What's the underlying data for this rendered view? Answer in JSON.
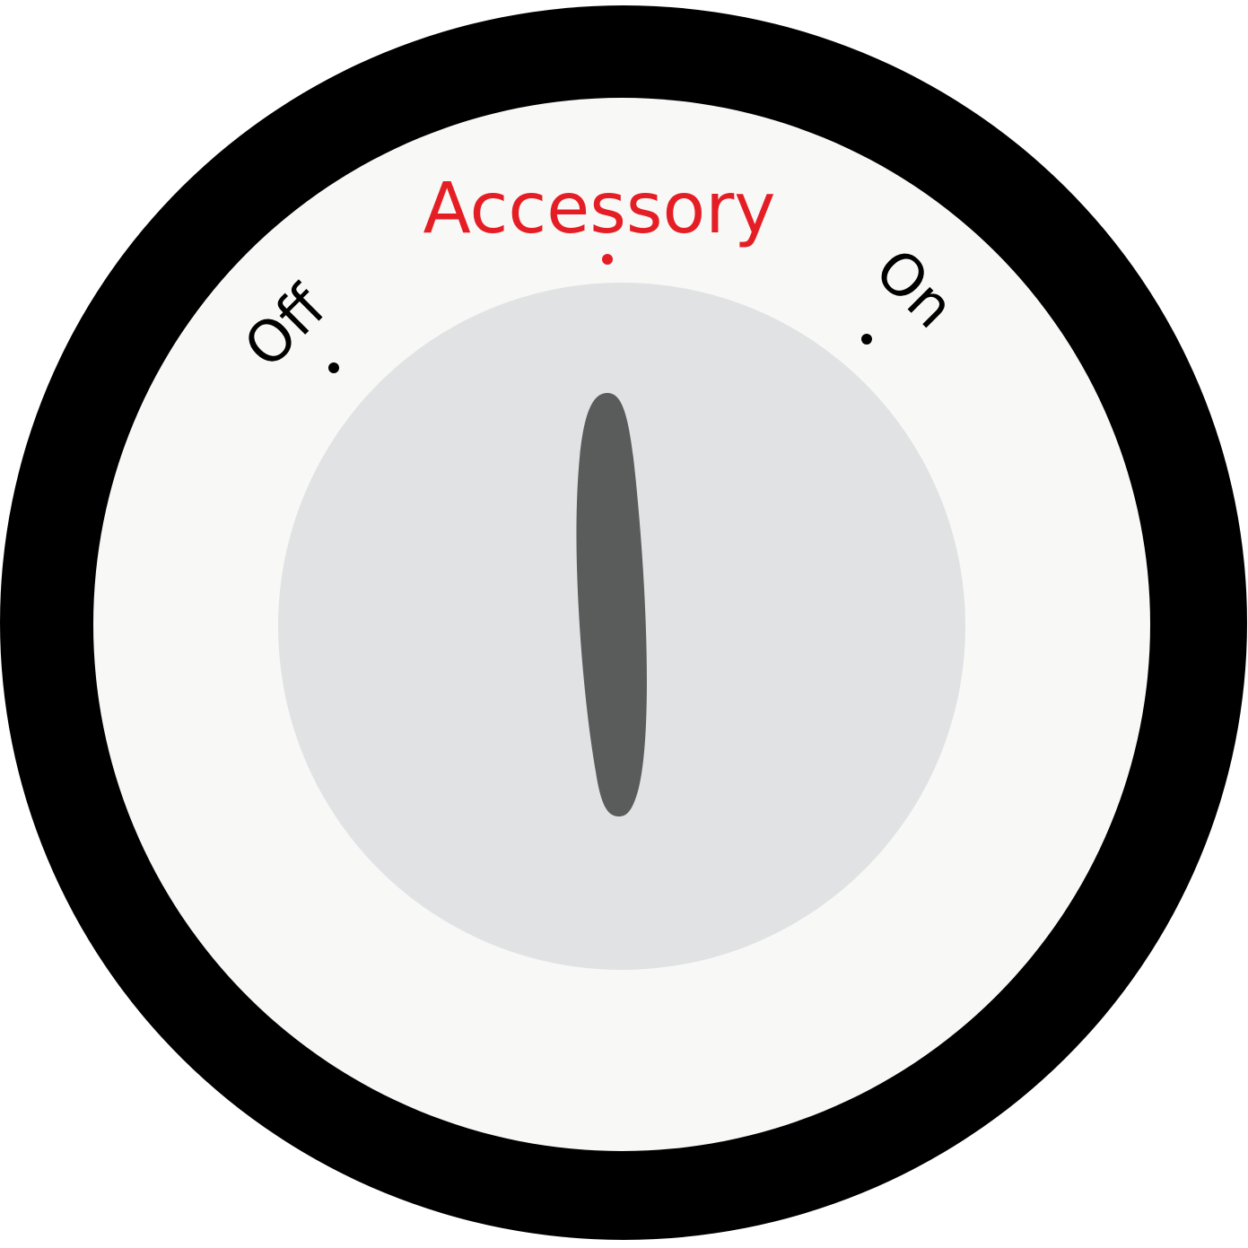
{
  "ignition": {
    "positions": [
      {
        "id": "off",
        "label": "Off",
        "selected": false
      },
      {
        "id": "accessory",
        "label": "Accessory",
        "selected": true
      },
      {
        "id": "on",
        "label": "On",
        "selected": false
      }
    ],
    "selected_position": "Accessory"
  },
  "colors": {
    "bezel": "#000000",
    "face": "#f8f8f6",
    "cylinder": "#e1e2e4",
    "keyway": "#5a5c5b",
    "label_default": "#000000",
    "label_selected": "#e51e25"
  },
  "icons": {
    "key_slot": "keyway-icon",
    "position_marker": "dot-icon"
  }
}
